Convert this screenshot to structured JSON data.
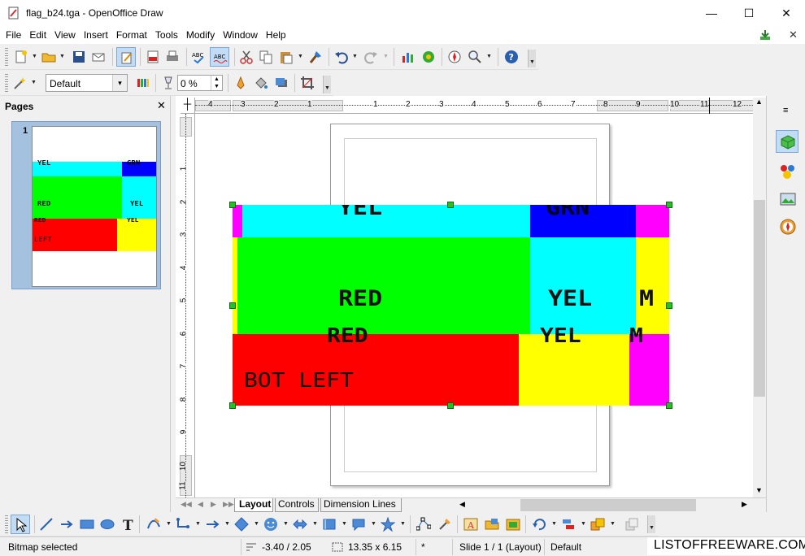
{
  "window": {
    "title": "flag_b24.tga - OpenOffice Draw",
    "minimize": "—",
    "maximize": "☐",
    "close": "✕"
  },
  "menu": [
    "File",
    "Edit",
    "View",
    "Insert",
    "Format",
    "Tools",
    "Modify",
    "Window",
    "Help"
  ],
  "toolbar2": {
    "style_value": "Default",
    "percent_value": "0 %"
  },
  "pages_panel": {
    "title": "Pages",
    "close": "✕",
    "page_number": "1",
    "thumb_labels": [
      "YEL",
      "GRN",
      "RED",
      "YEL",
      "RED",
      "YEL",
      "LEFT"
    ]
  },
  "ruler_h": [
    "4",
    "3",
    "2",
    "1",
    "1",
    "2",
    "3",
    "4",
    "5",
    "6",
    "7",
    "8",
    "9",
    "10",
    "11",
    "12"
  ],
  "ruler_v": [
    "1",
    "2",
    "3",
    "4",
    "5",
    "6",
    "7",
    "8",
    "9",
    "10",
    "11"
  ],
  "bitmap": {
    "labels": [
      "YEL",
      "GRN",
      "RED",
      "YEL",
      "M",
      "RED",
      "YEL",
      "M",
      "BOT LEFT"
    ],
    "colors": {
      "cyan": "#00ffff",
      "blue": "#0000ff",
      "magenta": "#ff00ff",
      "green": "#00ff00",
      "yellow": "#ffff00",
      "red": "#ff0000"
    }
  },
  "tabs": [
    "Layout",
    "Controls",
    "Dimension Lines"
  ],
  "status": {
    "selection": "Bitmap selected",
    "position": "-3.40 / 2.05",
    "size": "13.35 x 6.15",
    "modified": "*",
    "slide": "Slide 1 / 1 (Layout)",
    "layout": "Default",
    "watermark": "LISTOFFREEWARE.COM"
  },
  "accent_colors": {
    "highlight": "#c3dcf5",
    "selection_blue": "#a5c1e0"
  }
}
